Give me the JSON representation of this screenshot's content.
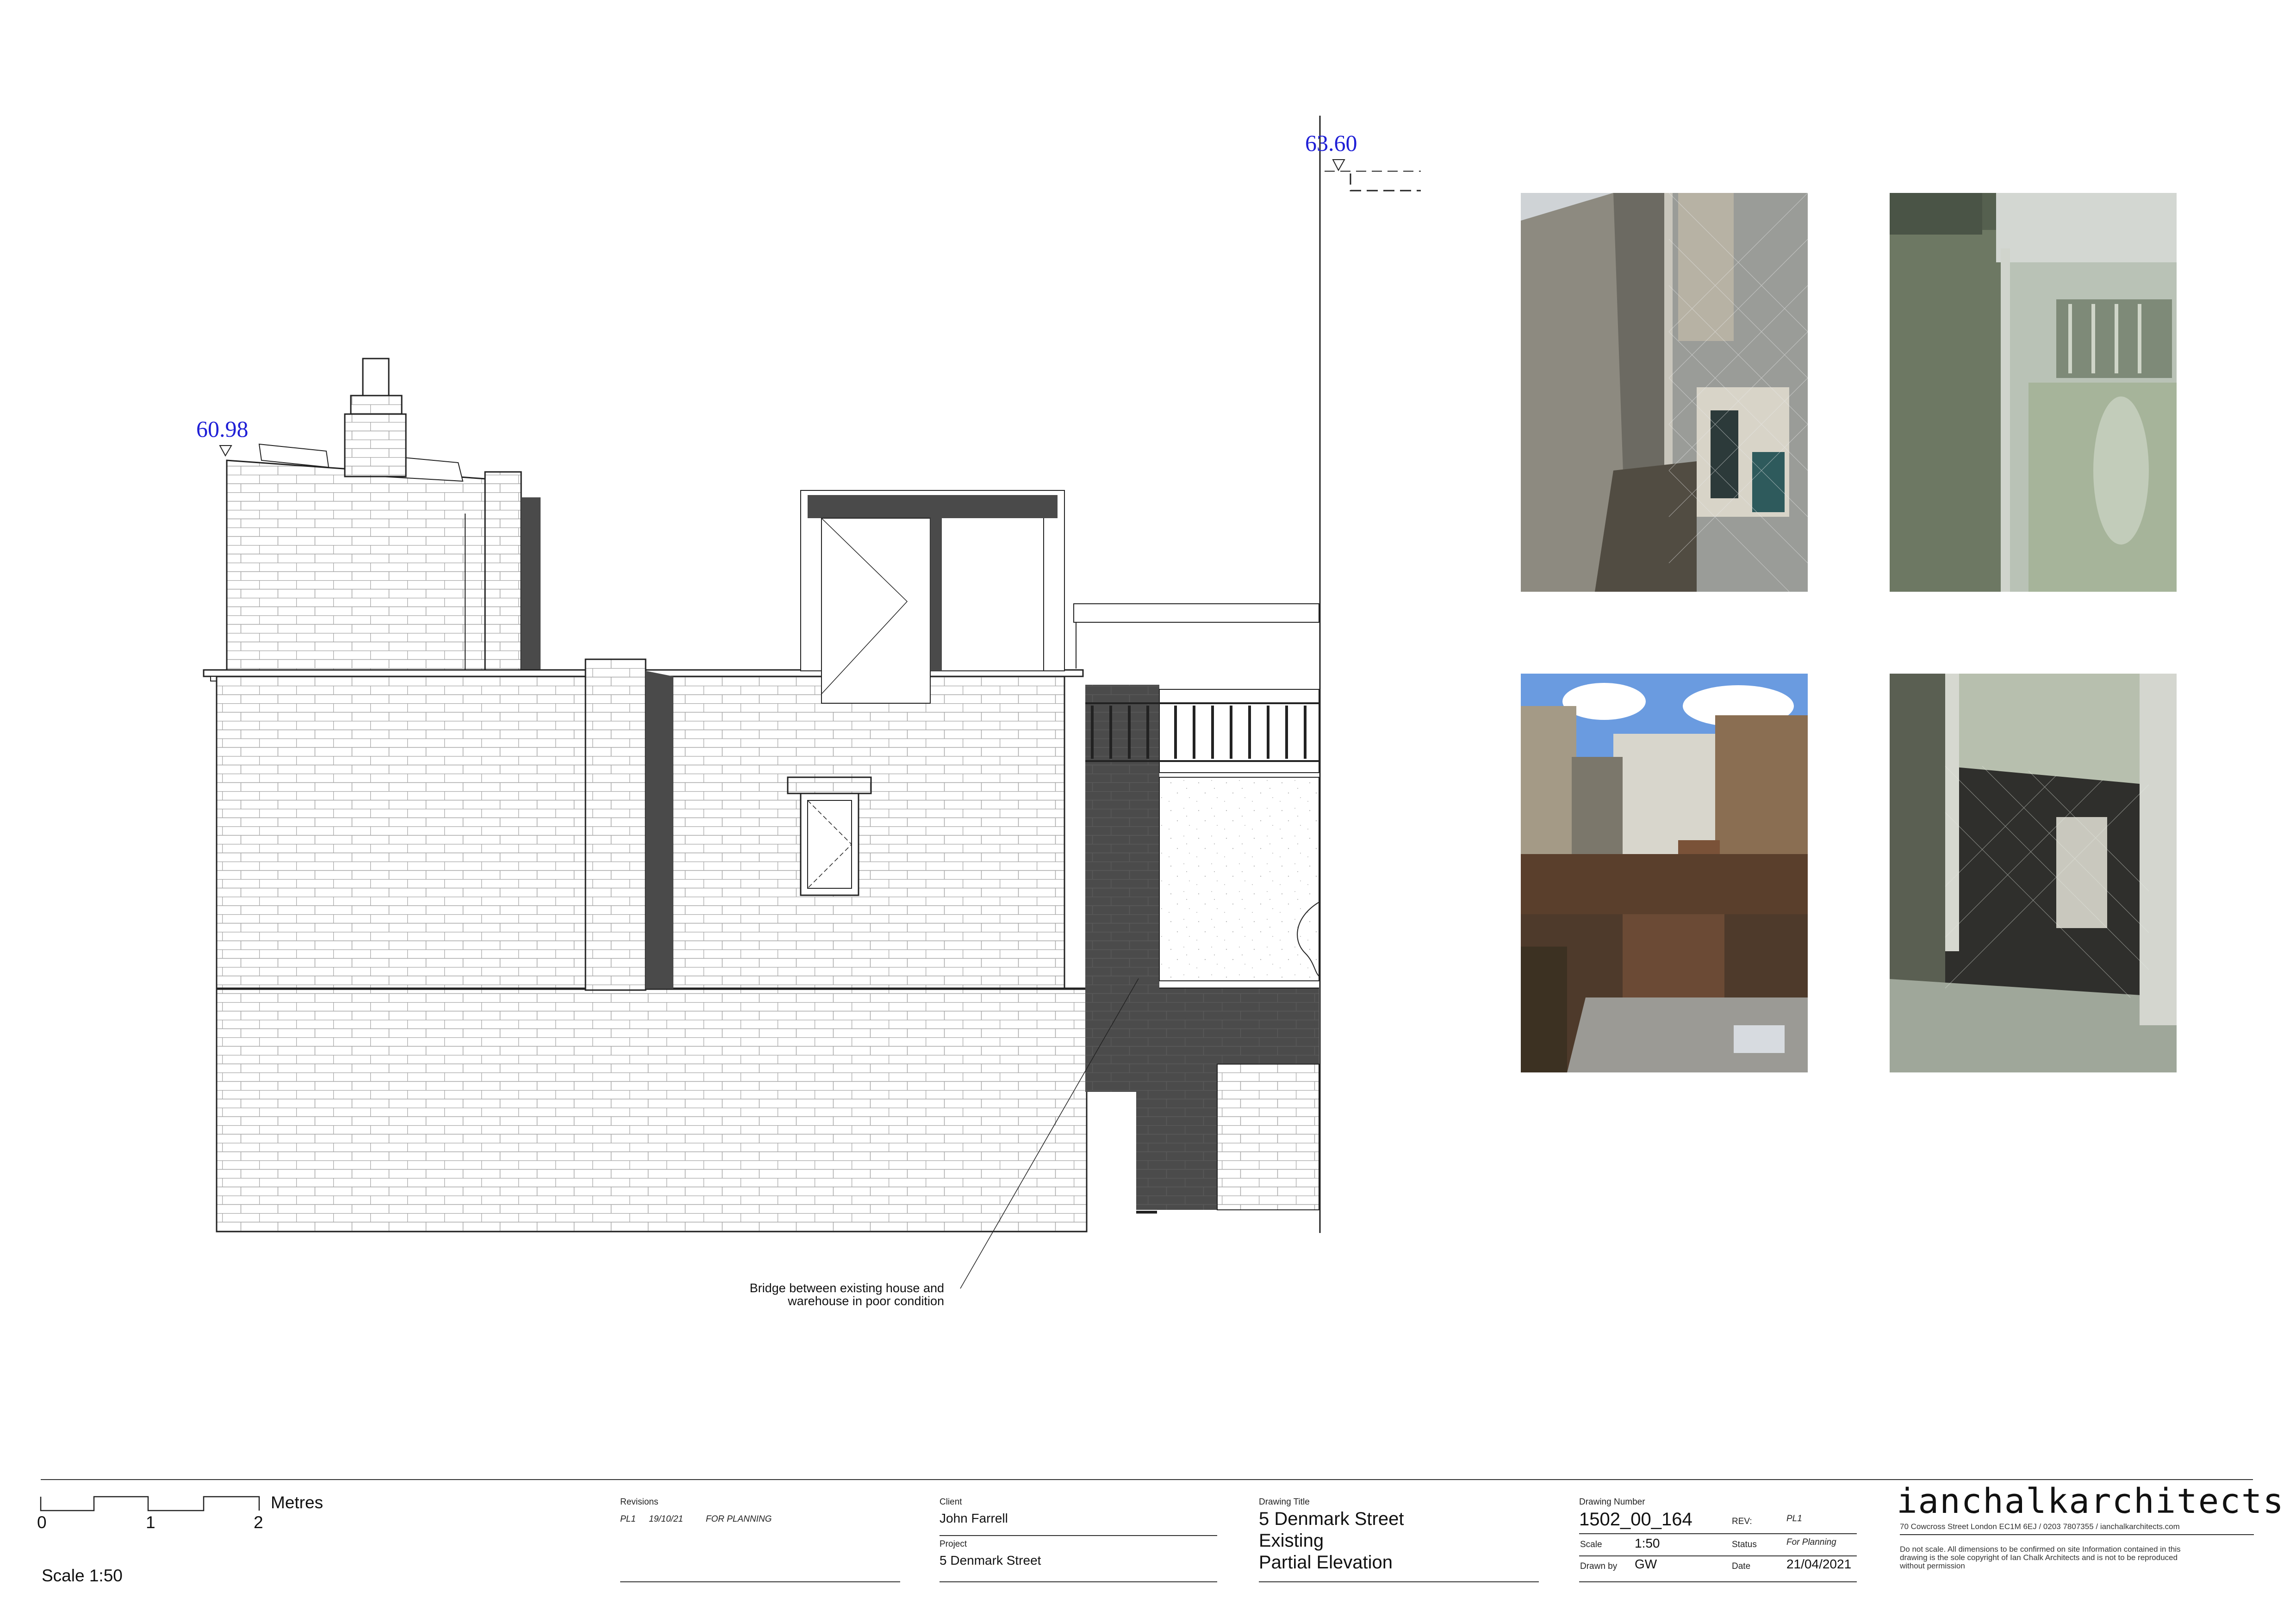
{
  "levels": {
    "parapet_left": "60.98",
    "roof_right": "63.60"
  },
  "annotation": {
    "line1": "Bridge between existing house and",
    "line2": "warehouse in poor condition"
  },
  "photos": [
    {
      "name": "photo-rear-wall-netting"
    },
    {
      "name": "photo-window-bay-netting"
    },
    {
      "name": "photo-courtyard-view"
    },
    {
      "name": "photo-lightwell-netting"
    }
  ],
  "scale_bar": {
    "ticks": [
      "0",
      "1",
      "2"
    ],
    "unit": "Metres",
    "scale_text": "Scale 1:50"
  },
  "revisions": {
    "label": "Revisions",
    "entries": [
      {
        "rev": "PL1",
        "date": "19/10/21",
        "desc": "FOR PLANNING"
      }
    ]
  },
  "client": {
    "label": "Client",
    "value": "John Farrell"
  },
  "project": {
    "label": "Project",
    "value": "5 Denmark Street"
  },
  "drawing_title": {
    "label": "Drawing Title",
    "line1": "5 Denmark Street",
    "line2": "Existing",
    "line3": "Partial Elevation"
  },
  "drawing_info": {
    "number_label": "Drawing Number",
    "number": "1502_00_164",
    "rev_label": "REV:",
    "rev": "PL1",
    "scale_label": "Scale",
    "scale": "1:50",
    "status_label": "Status",
    "status": "For Planning",
    "drawn_label": "Drawn by",
    "drawn": "GW",
    "date_label": "Date",
    "date": "21/04/2021"
  },
  "practice": {
    "logo": "ianchalkarchitects",
    "address": "70 Cowcross Street London EC1M 6EJ  /  0203 7807355  /  ianchalkarchitects.com",
    "disclaimer_1": "Do not scale. All dimensions to be confirmed on site Information contained in this",
    "disclaimer_2": "drawing is the sole copyright of Ian Chalk Architects and is not to be reproduced",
    "disclaimer_3": "without permission"
  },
  "colors": {
    "line": "#222222",
    "brick": "#9a9a9a",
    "shadow": "#4a4a4a",
    "level_text": "#1f1fd6"
  }
}
